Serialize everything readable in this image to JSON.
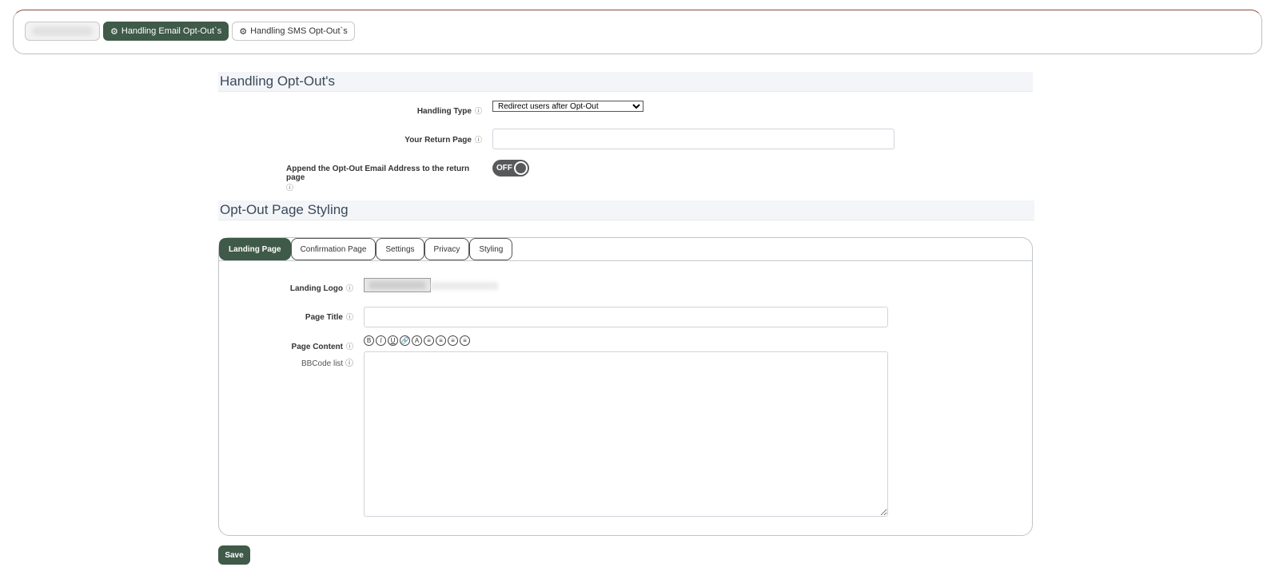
{
  "top_tabs": [
    {
      "label": ""
    },
    {
      "label": "Handling Email Opt-Out`s"
    },
    {
      "label": "Handling SMS Opt-Out`s"
    }
  ],
  "handling_section": {
    "title": "Handling Opt-Out's",
    "handling_type_label": "Handling Type",
    "handling_type_value": "Redirect users after Opt-Out",
    "return_page_label": "Your Return Page",
    "return_page_value": "",
    "append_label": "Append the Opt-Out Email Address to the return page",
    "append_toggle": "OFF"
  },
  "styling_section": {
    "title": "Opt-Out Page Styling",
    "tabs": [
      {
        "label": "Landing Page"
      },
      {
        "label": "Confirmation Page"
      },
      {
        "label": "Settings"
      },
      {
        "label": "Privacy"
      },
      {
        "label": "Styling"
      }
    ],
    "landing_logo_label": "Landing Logo",
    "page_title_label": "Page Title",
    "page_title_value": "",
    "page_content_label": "Page Content",
    "bbcode_label": "BBCode list",
    "bbcode_buttons": [
      "B",
      "I",
      "U",
      "🔗",
      "A",
      "≡",
      "≡",
      "≡",
      "≡"
    ],
    "page_content_value": ""
  },
  "save_label": "Save",
  "colors": {
    "accent": "#3f5a48",
    "toggle_off": "#58595b"
  }
}
